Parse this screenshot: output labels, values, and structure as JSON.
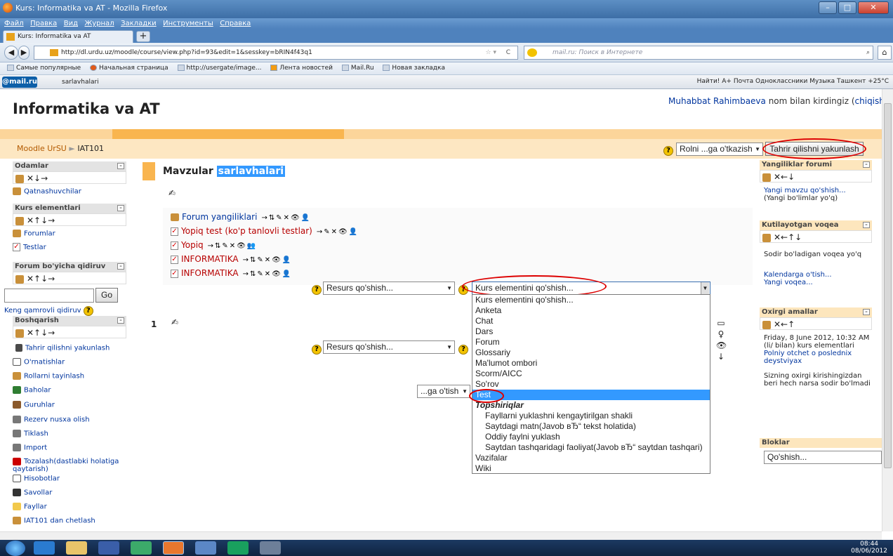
{
  "window": {
    "title": "Kurs: Informatika va AT - Mozilla Firefox",
    "menu": [
      "Файл",
      "Правка",
      "Вид",
      "Журнал",
      "Закладки",
      "Инструменты",
      "Справка"
    ],
    "tab_title": "Kurs: Informatika va AT",
    "url": "http://dl.urdu.uz/moodle/course/view.php?id=93&edit=1&sesskey=bRIN4f43q1",
    "search_placeholder": "mail.ru: Поиск в Интернете",
    "bookmarks": [
      "Самые популярные",
      "Начальная страница",
      "http://usergate/image...",
      "Лента новостей",
      "Mail.Ru",
      "Новая закладка"
    ],
    "mail_logo": "@mail.ru",
    "mail_search_value": "sarlavhalari",
    "mail_right": "Найти!  A+  Почта  Одноклассники  Музыка  Ташкент +25°C"
  },
  "site": {
    "title": "Informatika va AT",
    "login_user": "Muhabbat Rahimbaeva",
    "login_text": " nom bilan kirdingiz (",
    "login_logout": "chiqish",
    "login_close": ")",
    "breadcrumb_home": "Moodle UrSU",
    "breadcrumb_sep": " ► ",
    "breadcrumb_course": "IAT101",
    "role_switch": "Rolni ...ga o'tkazish",
    "edit_button": "Tahrir qilishni yakunlash"
  },
  "left_blocks": {
    "people_title": "Odamlar",
    "people_controls": "✕↓→",
    "participants": "Qatnashuvchilar",
    "activities_title": "Kurs elementlari",
    "activities_controls": "✕↑↓→",
    "forums": "Forumlar",
    "tests": "Testlar",
    "search_title": "Forum bo'yicha qidiruv",
    "search_controls": "✕↑↓→",
    "go": "Go",
    "advanced_search": "Keng qamrovli qidiruv",
    "admin_title": "Boshqarish",
    "admin_controls": "✕↑↓→",
    "admin_items": [
      "Tahrir qilishni yakunlash",
      "O'rnatishlar",
      "Rollarni tayinlash",
      "Baholar",
      "Guruhlar",
      "Rezerv nusxa olish",
      "Tiklash",
      "Import",
      "Tozalash(dastlabki holatiga qaytarish)",
      "Hisobotlar",
      "Savollar",
      "Fayllar",
      "IAT101 dan chetlash"
    ]
  },
  "main": {
    "topic_title": "Mavzular ",
    "topic_title_hl": "sarlavhalari",
    "activities": [
      {
        "name": "Forum yangiliklari",
        "controls": "→⇅✎✕👁👤"
      },
      {
        "name": "Yopiq test (ko'p tanlovli testlar)",
        "controls": "→✎✕👁👤"
      },
      {
        "name": "Yopiq",
        "controls": "→⇅✎✕👁👥"
      },
      {
        "name": "INFORMATIKA",
        "controls": "→⇅✎✕👁👤"
      },
      {
        "name": "INFORMATIKA",
        "controls": "→⇅✎✕👁👤"
      }
    ],
    "add_resource": "Resurs qo'shish...",
    "add_activity": "Kurs elementini qo'shish...",
    "section_number": "1",
    "jump": "...ga o'tish",
    "dropdown_options": [
      {
        "label": "Kurs elementini qo'shish...",
        "kind": "opt"
      },
      {
        "label": "Anketa",
        "kind": "opt"
      },
      {
        "label": "Chat",
        "kind": "opt"
      },
      {
        "label": "Dars",
        "kind": "opt"
      },
      {
        "label": "Forum",
        "kind": "opt"
      },
      {
        "label": "Glossariy",
        "kind": "opt"
      },
      {
        "label": "Ma'lumot ombori",
        "kind": "opt"
      },
      {
        "label": "Scorm/AICC",
        "kind": "opt"
      },
      {
        "label": "So'rov",
        "kind": "opt"
      },
      {
        "label": "Test",
        "kind": "sel"
      },
      {
        "label": "Topshiriqlar",
        "kind": "grp"
      },
      {
        "label": "Fayllarni yuklashni kengaytirilgan shakli",
        "kind": "sub"
      },
      {
        "label": "Saytdagi matn(Javob вЂ“ tekst holatida)",
        "kind": "sub"
      },
      {
        "label": "Oddiy faylni yuklash",
        "kind": "sub"
      },
      {
        "label": "Saytdan tashqaridagi faoliyat(Javob вЂ“ saytdan tashqari)",
        "kind": "sub"
      },
      {
        "label": "Vazifalar",
        "kind": "opt"
      },
      {
        "label": "Wiki",
        "kind": "opt"
      }
    ]
  },
  "right_blocks": {
    "news_title": "Yangiliklar forumi",
    "news_controls": "✕←↓",
    "news_add": "Yangi mavzu qo'shish...",
    "news_none": "(Yangi bo'limlar yo'q)",
    "events_title": "Kutilayotgan voqea",
    "events_controls": "✕←↑↓",
    "events_none": "Sodir bo'ladigan voqea yo'q",
    "events_calendar": "Kalendarga o'tish...",
    "events_new": "Yangi voqea...",
    "recent_title": "Oxirgi amallar",
    "recent_controls": "✕←↑",
    "recent_date": "Friday, 8 June 2012, 10:32 AM (li/ bilan) kurs elementlari",
    "recent_link": "Polniy otchet o poslednix deystviyax",
    "recent_none": "Sizning oxirgi kirishingizdan beri hech narsa sodir bo'lmadi",
    "blocks_title": "Bloklar",
    "blocks_add": "Qo'shish..."
  },
  "taskbar": {
    "time": "08:44",
    "date": "08/06/2012"
  }
}
